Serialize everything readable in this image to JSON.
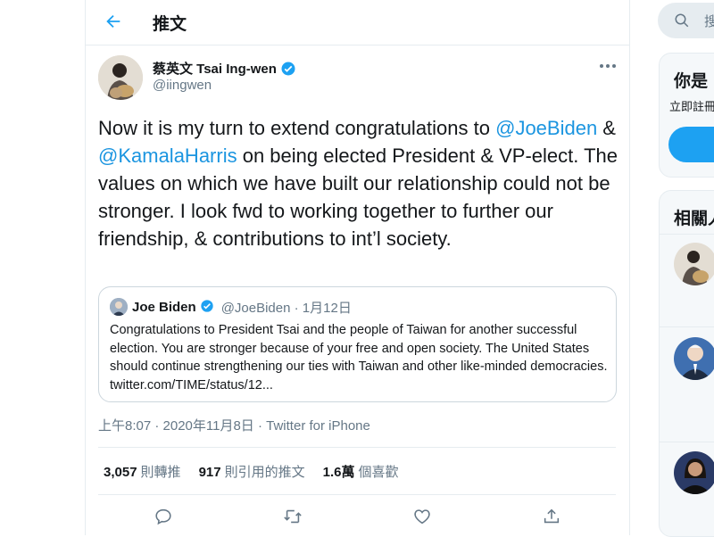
{
  "header": {
    "back_icon": "back-arrow-icon",
    "title": "推文"
  },
  "author": {
    "name": "蔡英文 Tsai Ing-wen",
    "handle": "@iingwen",
    "verified": true
  },
  "tweet": {
    "text_part1": "Now it is my turn to extend congratulations to ",
    "mention1": "@JoeBiden",
    "text_part2": " & ",
    "mention2": "@KamalaHarris",
    "text_part3": " on being elected President & VP-elect. The values on which we have built our relationship could not be stronger. I look fwd to working together to further our friendship, & contributions to int’l society."
  },
  "quote": {
    "name": "Joe Biden",
    "meta": "@JoeBiden · 1月12日",
    "text": "Congratulations to President Tsai and the people of Taiwan for another successful election. You are stronger because of your free and open society. The United States should continue strengthening our ties with Taiwan and other like-minded democracies. twitter.com/TIME/status/12..."
  },
  "timestamp": {
    "time": "上午8:07 · 2020年11月8日 · ",
    "source": "Twitter for iPhone"
  },
  "stats": {
    "retweets_count": "3,057",
    "retweets_label": "則轉推",
    "quotes_count": "917",
    "quotes_label": "則引用的推文",
    "likes_count": "1.6萬",
    "likes_label": "個喜歡"
  },
  "sidebar": {
    "search_placeholder": "搜",
    "signup_title": "你是",
    "signup_sub": "立即註冊",
    "related_title": "相關人"
  },
  "colors": {
    "accent": "#1da1f2",
    "link": "#1b95e0",
    "secondary_text": "#657786",
    "border": "#e6ecf0"
  }
}
